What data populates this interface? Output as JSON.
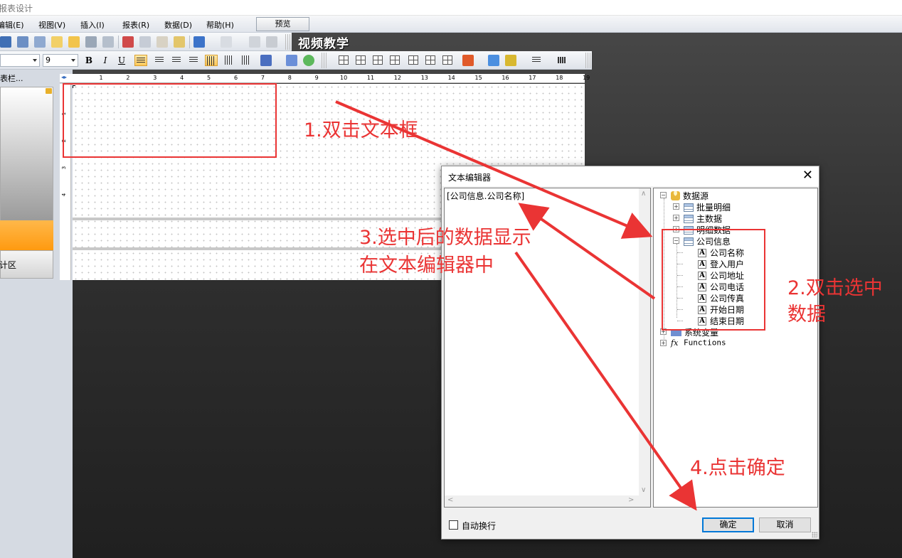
{
  "window": {
    "title": "报表设计"
  },
  "menu": {
    "items": [
      "编辑(E)",
      "视图(V)",
      "插入(I)",
      "报表(R)",
      "数据(D)",
      "帮助(H)"
    ],
    "preview_label": "预览"
  },
  "toolbar": {
    "video_teaching": "视频教学",
    "font_size": "9"
  },
  "left_panel": {
    "header": "表栏...",
    "calc_area": "计区"
  },
  "ruler": {
    "ticks": [
      "1",
      "2",
      "3",
      "4",
      "5",
      "6",
      "7",
      "8",
      "9",
      "10",
      "11",
      "12",
      "13",
      "14",
      "15",
      "16",
      "17",
      "18",
      "19"
    ],
    "vticks": [
      "1",
      "2",
      "3",
      "4"
    ]
  },
  "dialog": {
    "title": "文本编辑器",
    "close_glyph": "✕",
    "editor_text": "[公司信息.公司名称]",
    "tree": {
      "root": "数据源",
      "tables": [
        "批量明细",
        "主数据",
        "明细数据",
        "公司信息"
      ],
      "company_fields": [
        "公司名称",
        "登入用户",
        "公司地址",
        "公司电话",
        "公司传真",
        "开始日期",
        "结束日期"
      ],
      "system_vars": "系统变量",
      "functions": "Functions"
    },
    "auto_wrap_label": "自动换行",
    "ok_label": "确定",
    "cancel_label": "取消"
  },
  "annotations": {
    "step1": "1.双击文本框",
    "step2_line1": "2.双击选中",
    "step2_line2": "数据",
    "step3_line1": "3.选中后的数据显示",
    "step3_line2": "在文本编辑器中",
    "step4": "4.点击确定",
    "color": "#ea3434"
  }
}
